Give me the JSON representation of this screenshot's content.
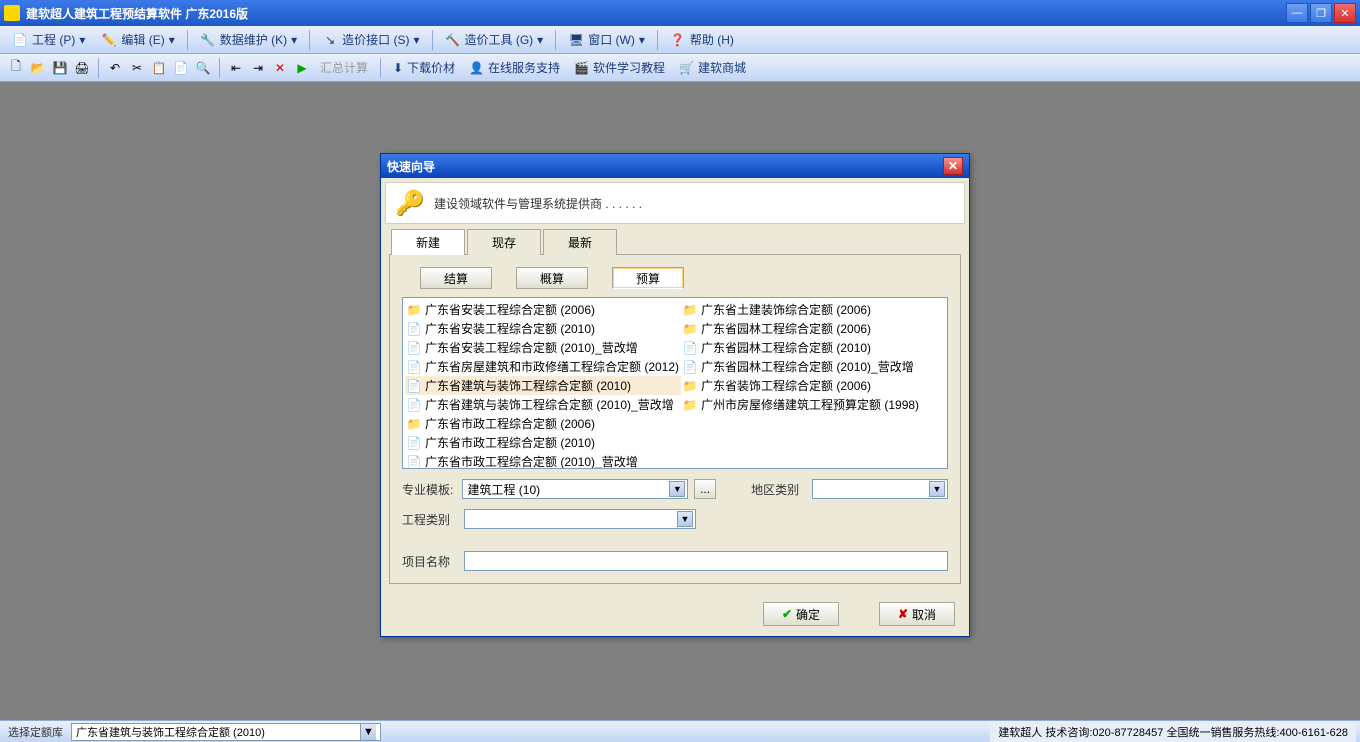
{
  "app": {
    "title": "建软超人建筑工程预结算软件  广东2016版"
  },
  "menu": {
    "items": [
      {
        "label": "工程 (P)",
        "icon": "📄"
      },
      {
        "label": "编辑 (E)",
        "icon": "✏️"
      },
      {
        "label": "数据维护 (K)",
        "icon": "🔧"
      },
      {
        "label": "造价接口 (S)",
        "icon": "↘"
      },
      {
        "label": "造价工具 (G)",
        "icon": "🔨"
      },
      {
        "label": "窗口 (W)",
        "icon": "🖥"
      },
      {
        "label": "帮助 (H)",
        "icon": "❓"
      }
    ]
  },
  "toolbar": {
    "summary": "汇总计算",
    "download": "下载价材",
    "online": "在线服务支持",
    "tutorial": "软件学习教程",
    "mall": "建软商城"
  },
  "statusbar": {
    "label": "选择定额库",
    "value": "广东省建筑与装饰工程综合定额 (2010)",
    "right": "建软超人 技术咨询:020-87728457 全国统一销售服务热线:400-6161-628"
  },
  "dialog": {
    "title": "快速向导",
    "banner": "建设领域软件与管理系统提供商 . . . . . .",
    "tabs": [
      "新建",
      "现存",
      "最新"
    ],
    "active_tab": 0,
    "subtabs": [
      "结算",
      "概算",
      "预算"
    ],
    "active_subtab": 2,
    "list_left": [
      {
        "icon": "folder",
        "label": "广东省安装工程综合定额 (2006)"
      },
      {
        "icon": "doc",
        "label": "广东省安装工程综合定额 (2010)"
      },
      {
        "icon": "doc",
        "label": "广东省安装工程综合定额 (2010)_营改增"
      },
      {
        "icon": "doc",
        "label": "广东省房屋建筑和市政修缮工程综合定额 (2012)"
      },
      {
        "icon": "doc",
        "label": "广东省建筑与装饰工程综合定额 (2010)",
        "selected": true
      },
      {
        "icon": "doc",
        "label": "广东省建筑与装饰工程综合定额 (2010)_营改增"
      },
      {
        "icon": "folder",
        "label": "广东省市政工程综合定额 (2006)"
      },
      {
        "icon": "doc",
        "label": "广东省市政工程综合定额 (2010)"
      },
      {
        "icon": "doc",
        "label": "广东省市政工程综合定额 (2010)_营改增"
      }
    ],
    "list_right": [
      {
        "icon": "folder",
        "label": "广东省土建装饰综合定额 (2006)"
      },
      {
        "icon": "folder",
        "label": "广东省园林工程综合定额 (2006)"
      },
      {
        "icon": "doc",
        "label": "广东省园林工程综合定额 (2010)"
      },
      {
        "icon": "doc",
        "label": "广东省园林工程综合定额 (2010)_营改增"
      },
      {
        "icon": "folder",
        "label": "广东省装饰工程综合定额 (2006)"
      },
      {
        "icon": "folder",
        "label": "广州市房屋修缮建筑工程预算定额 (1998)"
      }
    ],
    "form": {
      "template_label": "专业模板:",
      "template_value": "建筑工程 (10)",
      "region_label": "地区类别",
      "region_value": "",
      "category_label": "工程类别",
      "category_value": "",
      "name_label": "项目名称",
      "name_value": ""
    },
    "buttons": {
      "ok": "确定",
      "cancel": "取消"
    }
  }
}
